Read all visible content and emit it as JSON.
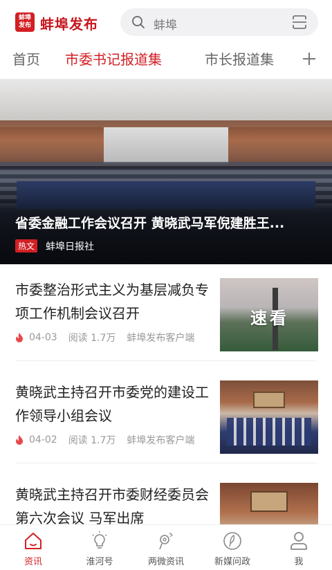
{
  "header": {
    "logo_badge_line1": "蚌埠",
    "logo_badge_line2": "发布",
    "logo_text": "蚌埠发布",
    "search_placeholder": "蚌埠"
  },
  "tabs": [
    {
      "label": "首页",
      "active": false
    },
    {
      "label": "市委书记报道集",
      "active": true
    },
    {
      "label": "市长报道集",
      "active": false
    }
  ],
  "banner": {
    "title": "省委金融工作会议召开  黄晓武马军倪建胜王...",
    "badge": "热文",
    "source": "蚌埠日报社"
  },
  "news": [
    {
      "title": "市委整治形式主义为基层减负专项工作机制会议召开",
      "date": "04-03",
      "reads": "阅读 1.7万",
      "source": "蚌埠发布客户端",
      "thumb_text": "速看"
    },
    {
      "title": "黄晓武主持召开市委党的建设工作领导小组会议",
      "date": "04-02",
      "reads": "阅读 1.7万",
      "source": "蚌埠发布客户端"
    },
    {
      "title": "黄晓武主持召开市委财经委员会第六次会议 马军出席"
    }
  ],
  "bottom_nav": [
    {
      "label": "资讯",
      "icon": "home-icon",
      "active": true
    },
    {
      "label": "淮河号",
      "icon": "bulb-icon",
      "active": false
    },
    {
      "label": "两微资讯",
      "icon": "weibo-icon",
      "active": false
    },
    {
      "label": "新媒问政",
      "icon": "feather-icon",
      "active": false
    },
    {
      "label": "我",
      "icon": "user-icon",
      "active": false
    }
  ],
  "colors": {
    "accent": "#d21f24",
    "text": "#222222",
    "muted": "#999999"
  }
}
